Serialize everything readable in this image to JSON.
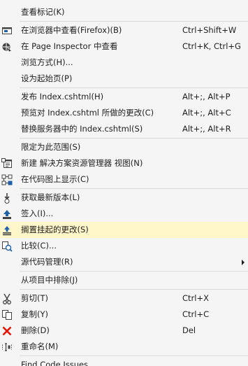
{
  "menu": {
    "items": [
      {
        "label": "查看标记(K)",
        "shortcut": "",
        "icon": ""
      },
      {
        "label": "在浏览器中查看(Firefox)(B)",
        "shortcut": "Ctrl+Shift+W",
        "icon": "browser-view-icon"
      },
      {
        "label": "在 Page Inspector 中查看",
        "shortcut": "Ctrl+K, Ctrl+G",
        "icon": "page-inspector-icon"
      },
      {
        "label": "浏览方式(H)...",
        "shortcut": "",
        "icon": ""
      },
      {
        "label": "设为起始页(P)",
        "shortcut": "",
        "icon": ""
      },
      {
        "label": "发布 Index.cshtml(H)",
        "shortcut": "Alt+;, Alt+P",
        "icon": ""
      },
      {
        "label": "预览对 Index.cshtml 所做的更改(C)",
        "shortcut": "Alt+;, Alt+C",
        "icon": ""
      },
      {
        "label": "替换服务器中的 Index.cshtml(S)",
        "shortcut": "Alt+;, Alt+R",
        "icon": ""
      },
      {
        "label": "限定为此范围(S)",
        "shortcut": "",
        "icon": ""
      },
      {
        "label": "新建 解决方案资源管理器 视图(N)",
        "shortcut": "",
        "icon": "new-solution-view-icon"
      },
      {
        "label": "在代码图上显示(C)",
        "shortcut": "",
        "icon": "code-map-icon"
      },
      {
        "label": "获取最新版本(L)",
        "shortcut": "",
        "icon": "get-latest-icon"
      },
      {
        "label": "签入(I)...",
        "shortcut": "",
        "icon": "check-in-icon"
      },
      {
        "label": "搁置挂起的更改(S)",
        "shortcut": "",
        "icon": "shelve-icon"
      },
      {
        "label": "比较(C)...",
        "shortcut": "",
        "icon": "compare-icon"
      },
      {
        "label": "源代码管理(R)",
        "shortcut": "",
        "icon": "",
        "submenu": true
      },
      {
        "label": "从项目中排除(J)",
        "shortcut": "",
        "icon": ""
      },
      {
        "label": "剪切(T)",
        "shortcut": "Ctrl+X",
        "icon": "cut-icon"
      },
      {
        "label": "复制(Y)",
        "shortcut": "Ctrl+C",
        "icon": "copy-icon"
      },
      {
        "label": "删除(D)",
        "shortcut": "Del",
        "icon": "delete-icon"
      },
      {
        "label": "重命名(M)",
        "shortcut": "",
        "icon": "rename-icon"
      },
      {
        "label": "Find Code Issues",
        "shortcut": "",
        "icon": ""
      }
    ],
    "highlighted_item": "搁置挂起的更改(S)",
    "colors": {
      "background": "#f5f5f5",
      "highlight": "#fff6c9",
      "separator": "#d9d9d9",
      "text": "#1e1e1e",
      "icon_blue": "#1e5fa8",
      "delete_red": "#e51400"
    }
  }
}
